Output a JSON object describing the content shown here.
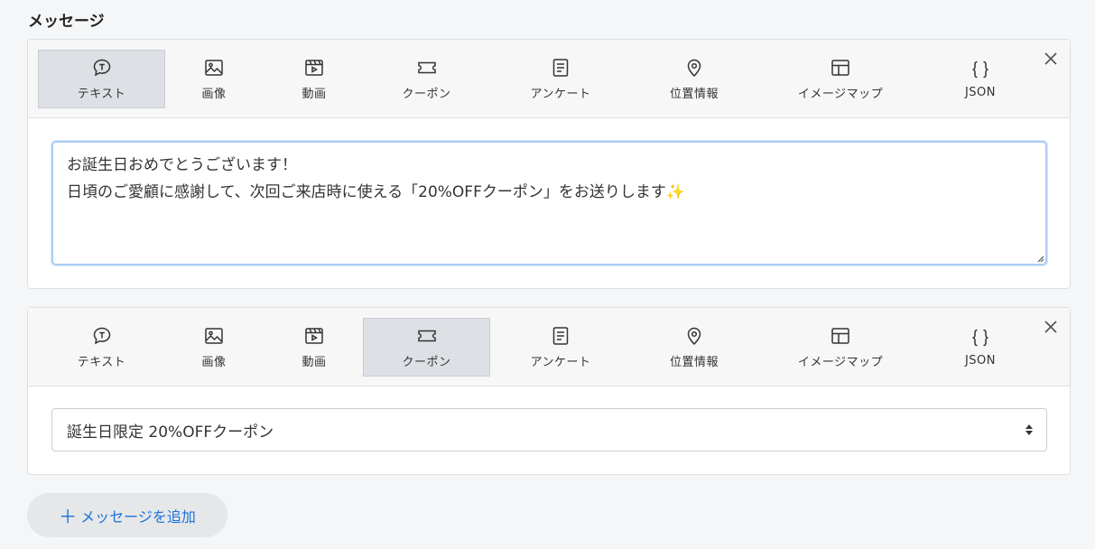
{
  "section": {
    "title": "メッセージ"
  },
  "tabs": [
    {
      "label": "テキスト",
      "icon": "text-bubble-icon"
    },
    {
      "label": "画像",
      "icon": "image-icon"
    },
    {
      "label": "動画",
      "icon": "video-icon"
    },
    {
      "label": "クーポン",
      "icon": "coupon-icon"
    },
    {
      "label": "アンケート",
      "icon": "survey-icon"
    },
    {
      "label": "位置情報",
      "icon": "location-pin-icon"
    },
    {
      "label": "イメージマップ",
      "icon": "imagemap-icon"
    },
    {
      "label": "JSON",
      "icon": "json-braces-icon"
    }
  ],
  "messages": [
    {
      "type": "テキスト",
      "text": "お誕生日おめでとうございます！\n日頃のご愛顧に感謝して、次回ご来店時に使える「20%OFFクーポン」をお送りします✨"
    },
    {
      "type": "クーポン",
      "selected_coupon": "誕生日限定 20%OFFクーポン"
    }
  ],
  "add_button": {
    "label": "メッセージを追加",
    "icon": "plus-icon"
  },
  "colors": {
    "accent": "#1a73d9",
    "focus_border": "#a9cdf3",
    "active_tab": "#dde1e6"
  }
}
